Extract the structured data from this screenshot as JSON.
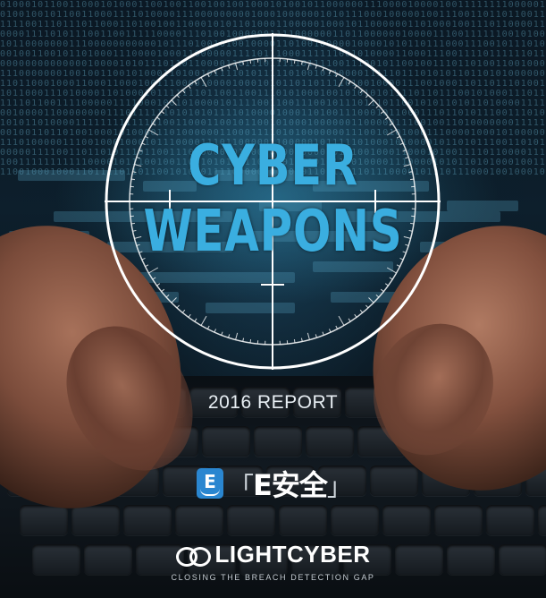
{
  "cover": {
    "title_line1": "CYBER",
    "title_line2": "WEAPONS",
    "subtitle": "2016 REPORT",
    "watermark_badge": {
      "icon": "e-book-icon",
      "letter": "E",
      "bracket_open": "「",
      "text": "E安全",
      "bracket_close": "」"
    },
    "brand": {
      "logo": "linked-rings-logo-icon",
      "name": "LIGHTCYBER",
      "tagline": "CLOSING THE BREACH DETECTION GAP"
    }
  },
  "colors": {
    "title": "#3aaee0",
    "reticle": "#ffffff",
    "badge_bg": "#2a86d0",
    "text_light": "#e7eef3"
  }
}
